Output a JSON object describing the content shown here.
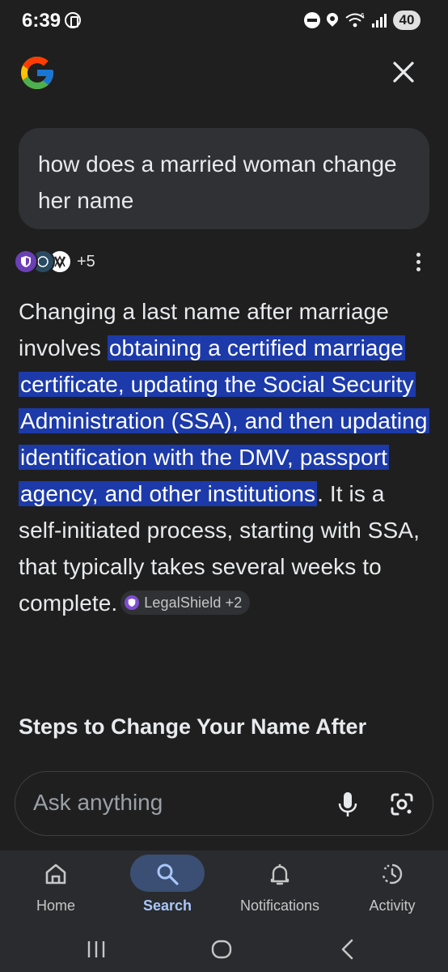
{
  "status_bar": {
    "time": "6:39",
    "battery": "40"
  },
  "query": {
    "text": "how does a married woman change her name"
  },
  "sources": {
    "more_count": "+5"
  },
  "answer": {
    "intro": "Changing a last name after marriage involves ",
    "highlight": "obtaining a certified marriage certificate, updating the Social Security Administration (SSA), and then updating identification with the DMV, passport agency, and other institutions",
    "rest": ". It is a self-initiated process, starting with SSA, that typically takes several weeks to complete.",
    "citation": "LegalShield +2"
  },
  "section_heading": "Steps to Change Your Name After",
  "ask_bar": {
    "placeholder": "Ask anything"
  },
  "bottom_nav": {
    "items": [
      {
        "label": "Home",
        "icon": "home-icon"
      },
      {
        "label": "Search",
        "icon": "search-icon",
        "active": true
      },
      {
        "label": "Notifications",
        "icon": "bell-icon"
      },
      {
        "label": "Activity",
        "icon": "activity-icon"
      }
    ]
  },
  "colors": {
    "background": "#1f1f1f",
    "highlight": "#1c3aa9",
    "active_nav": "#a8c7fa",
    "active_pill": "#3b4e73"
  }
}
